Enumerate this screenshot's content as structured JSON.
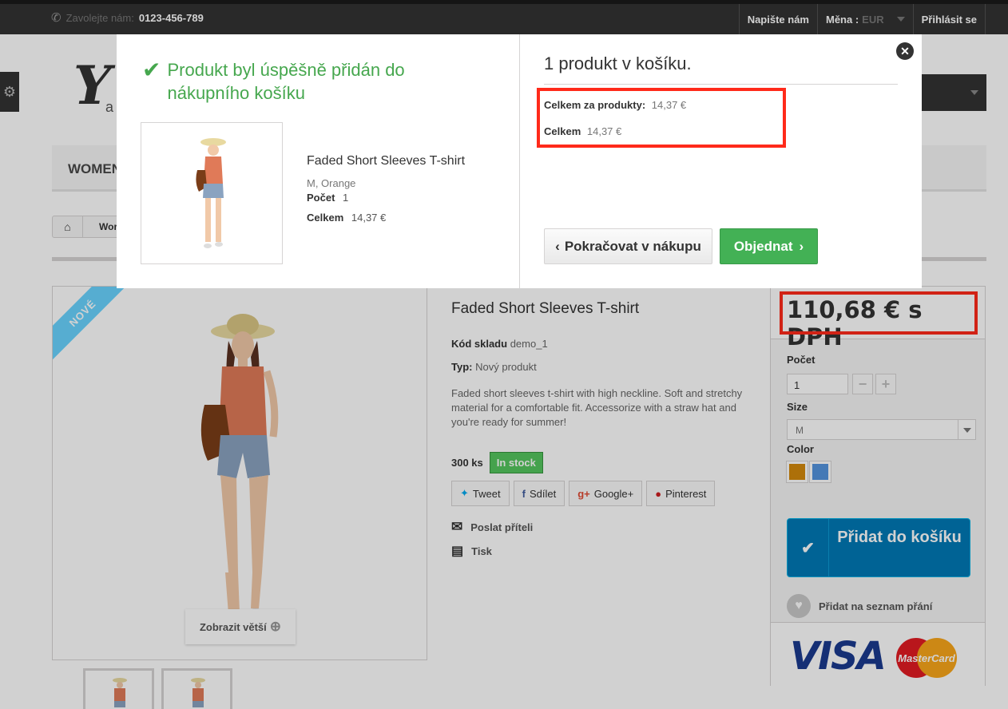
{
  "topbar": {
    "phone_label": "Zavolejte nám:",
    "phone_number": "0123-456-789",
    "contact": "Napište nám",
    "currency_label": "Měna :",
    "currency_value": "EUR",
    "login": "Přihlásit se"
  },
  "page": {
    "logo_letter": "Y",
    "logo_sub": "a",
    "menu_first": "WOMEN",
    "breadcrumb_crumb": "Wor",
    "new_badge": "NOVÉ",
    "zoom_label": "Zobrazit větší",
    "product_title": "Faded Short Sleeves T-shirt",
    "sku_label": "Kód skladu",
    "sku_value": "demo_1",
    "condition_label": "Typ:",
    "condition_value": "Nový produkt",
    "description": "Faded short sleeves t-shirt with high neckline. Soft and stretchy material for a comfortable fit. Accessorize with a straw hat and you're ready for summer!",
    "stock_qty": "300 ks",
    "stock_status": "In stock",
    "social": {
      "tweet": "Tweet",
      "share": "Sdílet",
      "google": "Google+",
      "pinterest": "Pinterest"
    },
    "send_friend": "Poslat příteli",
    "print": "Tisk"
  },
  "buybox": {
    "price": "110,68 € s DPH",
    "qty_label": "Počet",
    "qty_value": "1",
    "size_label": "Size",
    "size_value": "M",
    "color_label": "Color",
    "colors": [
      "#d4890c",
      "#5494df"
    ],
    "add_to_cart": "Přidat do košíku",
    "wishlist": "Přidat na seznam přání",
    "visa": "VISA",
    "mastercard": "MasterCard"
  },
  "modal": {
    "success_message": "Produkt byl úspěšně přidán do nákupního košíku",
    "product_name": "Faded Short Sleeves T-shirt",
    "product_attributes": "M, Orange",
    "qty_label": "Počet",
    "qty_value": "1",
    "total_label": "Celkem",
    "total_value": "14,37 €",
    "cart_heading": "1 produkt v košíku.",
    "cart_products_label": "Celkem za produkty:",
    "cart_products_value": "14,37 €",
    "cart_total_label": "Celkem",
    "cart_total_value": "14,37 €",
    "continue_button": "Pokračovat v nákupu",
    "order_button": "Objednat"
  },
  "colors": {
    "success_green": "#46a74e",
    "order_green": "#43b155",
    "cart_blue": "#0079b6",
    "highlight_red": "#ff2a1a"
  }
}
